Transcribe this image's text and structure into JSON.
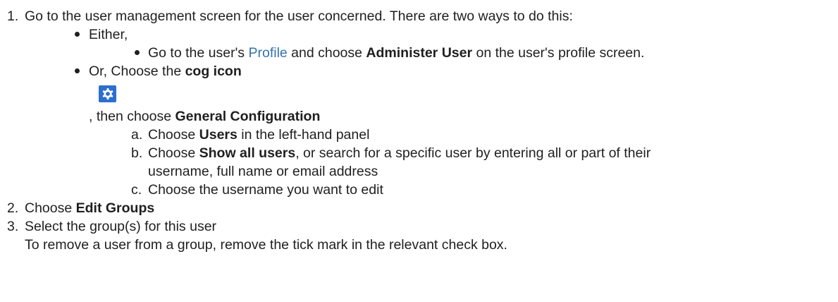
{
  "steps": [
    {
      "marker": "1.",
      "text": "Go to the user management screen for the user concerned. There are two ways to do this:",
      "options": [
        {
          "text": "Either,",
          "sub": {
            "before": "Go to the user's ",
            "link": "Profile",
            "middle": " and choose ",
            "bold": "Administer User",
            "after": " on the user's profile screen."
          }
        },
        {
          "prefix": "Or, Choose the ",
          "bold": "cog icon",
          "icon": "cog-icon",
          "then_prefix": ", then choose ",
          "then_bold": "General Configuration",
          "substeps": [
            {
              "marker": "a.",
              "before": "Choose ",
              "bold": "Users",
              "after": " in the left-hand panel"
            },
            {
              "marker": "b.",
              "before": "Choose ",
              "bold": "Show all users",
              "after": ", or search for a specific user by entering all or part of their",
              "continuation": "username, full name or email address"
            },
            {
              "marker": "c.",
              "text": "Choose the username you want to edit"
            }
          ]
        }
      ]
    },
    {
      "marker": "2.",
      "before": "Choose ",
      "bold": "Edit Groups"
    },
    {
      "marker": "3.",
      "text": "Select the group(s) for this user",
      "note": "To remove a user from a group, remove the tick mark in the relevant check box."
    }
  ],
  "colors": {
    "link": "#3572b0",
    "cog_background": "#2d6fcf",
    "text": "#1f1f1f"
  }
}
